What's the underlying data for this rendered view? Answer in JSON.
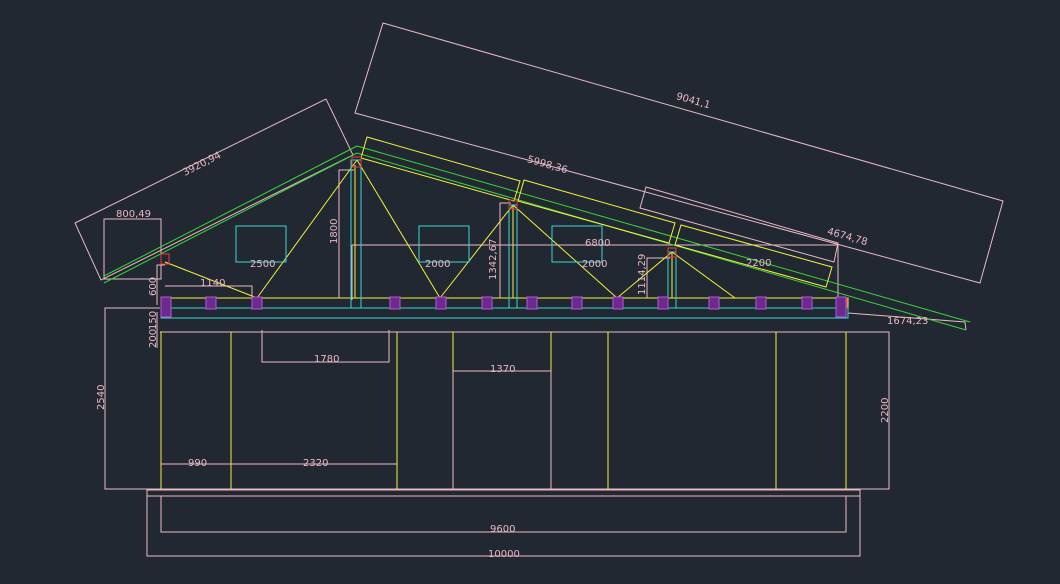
{
  "drawing": {
    "colors": {
      "background": "#222831",
      "dimension": "#e9b8c4",
      "truss": "#f2f23c",
      "roof": "#39d639",
      "beam": "#35d6d6",
      "connector": "#e83a3a",
      "block": "#b45ad6"
    },
    "dimensions": {
      "roof_long": "9041,1",
      "roof_left": "3920,94",
      "rafter_top": "5998,36",
      "rafter_right": "4674,78",
      "overhang_left": "800,49",
      "overhang_right": "1674,23",
      "kingpost": "1800",
      "post_mid": "1342,67",
      "post_right": "1114,29",
      "span_top": "6800",
      "win1": "2500",
      "win2": "2000",
      "win3": "2000",
      "win4": "2200",
      "seg_1140": "1140",
      "h600": "600",
      "h200": "200",
      "h150": "150",
      "wall_left": "2540",
      "wall_right": "2200",
      "opening_1780": "1780",
      "opening_1370": "1370",
      "bottom_990": "990",
      "bottom_2320": "2320",
      "total_9600": "9600",
      "total_10000": "10000"
    }
  }
}
